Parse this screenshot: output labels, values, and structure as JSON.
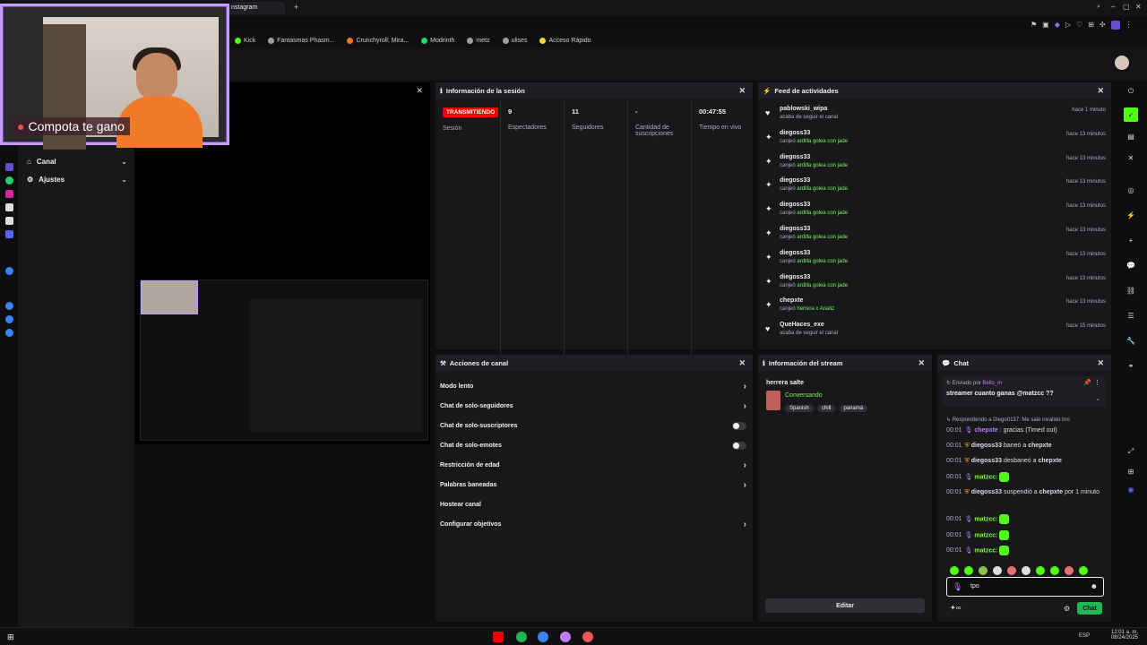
{
  "browser": {
    "tab_title": "nstagram",
    "new_tab_glyph": "+",
    "bookmarks": [
      {
        "label": "Kick",
        "color": "#53fc18"
      },
      {
        "label": "Fantasmas Phasm...",
        "color": "#9e9e9e"
      },
      {
        "label": "Crunchyroll: Mira...",
        "color": "#f47521"
      },
      {
        "label": "Modrinth",
        "color": "#1bd96a"
      },
      {
        "label": "metz",
        "color": "#9e9e9e"
      },
      {
        "label": "ulises",
        "color": "#9e9e9e"
      },
      {
        "label": "Acceso Rápido",
        "color": "#f5d442"
      }
    ]
  },
  "webcam": {
    "caption": "Compota te gano"
  },
  "sidenav": {
    "items": [
      {
        "label": "Canal",
        "chevron": "⌄"
      },
      {
        "label": "Ajustes",
        "chevron": "⌄"
      }
    ]
  },
  "session": {
    "title": "Información de la sesión",
    "live_badge": "TRANSMITIENDO",
    "session_label": "Sesión",
    "stats": [
      {
        "value": "9",
        "label": "Espectadores"
      },
      {
        "value": "11",
        "label": "Seguidores"
      },
      {
        "value": "-",
        "label": "Cantidad de suscripciones"
      },
      {
        "value": "00:47:55",
        "label": "Tiempo en vivo"
      }
    ]
  },
  "feed": {
    "title": "Feed de actividades",
    "items": [
      {
        "user": "pablowski_wipa",
        "desc": "acaba de seguir el canal",
        "highlight": "",
        "time": "hace 1 minuto",
        "icon": "heart"
      },
      {
        "user": "diegoss33",
        "desc": "canjeó",
        "highlight": "ardilla golea con jade",
        "time": "hace 13 minutos",
        "icon": "points"
      },
      {
        "user": "diegoss33",
        "desc": "canjeó",
        "highlight": "ardilla golea con jade",
        "time": "hace 13 minutos",
        "icon": "points"
      },
      {
        "user": "diegoss33",
        "desc": "canjeó",
        "highlight": "ardilla golea con jade",
        "time": "hace 13 minutos",
        "icon": "points"
      },
      {
        "user": "diegoss33",
        "desc": "canjeó",
        "highlight": "ardilla golea con jade",
        "time": "hace 13 minutos",
        "icon": "points"
      },
      {
        "user": "diegoss33",
        "desc": "canjeó",
        "highlight": "ardilla golea con jade",
        "time": "hace 13 minutos",
        "icon": "points"
      },
      {
        "user": "diegoss33",
        "desc": "canjeó",
        "highlight": "ardilla golea con jade",
        "time": "hace 13 minutos",
        "icon": "points"
      },
      {
        "user": "diegoss33",
        "desc": "canjeó",
        "highlight": "ardilla golea con jade",
        "time": "hace 13 minutos",
        "icon": "points"
      },
      {
        "user": "chepxte",
        "desc": "canjeó",
        "highlight": "herrera x Analiz",
        "time": "hace 13 minutos",
        "icon": "points"
      },
      {
        "user": "QueHaces_exe",
        "desc": "acaba de seguir el canal",
        "highlight": "",
        "time": "hace 15 minutos",
        "icon": "heart"
      }
    ]
  },
  "actions": {
    "title": "Acciones de canal",
    "rows": [
      {
        "label": "Modo lento",
        "control": "chevron"
      },
      {
        "label": "Chat de solo-seguidores",
        "control": "chevron"
      },
      {
        "label": "Chat de solo-suscriptores",
        "control": "toggle"
      },
      {
        "label": "Chat de solo-emotes",
        "control": "toggle"
      },
      {
        "label": "Restricción de edad",
        "control": "chevron"
      },
      {
        "label": "Palabras baneadas",
        "control": "chevron"
      },
      {
        "label": "Hostear canal",
        "control": "none"
      },
      {
        "label": "Configurar objetivos",
        "control": "chevron"
      }
    ]
  },
  "stream_info": {
    "title": "Información del stream",
    "stream_title": "herrera salte",
    "category": "Conversando",
    "tags": [
      "Spanish",
      "chill",
      "panamá"
    ],
    "edit_label": "Editar"
  },
  "chat": {
    "title": "Chat",
    "pinned_from_prefix": "Enviado por",
    "pinned_from_user": "Bello_m",
    "pinned_text": "streamer cuanto ganas @matzcc ??",
    "reply_hint": "Respondiendo a Diego0137: Me sale invalido bro",
    "messages": [
      {
        "time": "00:01",
        "user": "chepxte",
        "text": ": gracias (Timed out)",
        "color": "#c27bff",
        "emote": false
      },
      {
        "time": "00:01",
        "user": "diegoss33",
        "text": "baneó a",
        "target": "chepxte",
        "color": "#dedee3",
        "emote": false
      },
      {
        "time": "00:01",
        "user": "diegoss33",
        "text": "desbaneó a",
        "target": "chepxte",
        "color": "#dedee3",
        "emote": false
      },
      {
        "time": "00:01",
        "user": "matzcc:",
        "text": "",
        "color": "#7bf55a",
        "emote": true
      },
      {
        "time": "00:01",
        "user": "diegoss33",
        "text": "suspendió a",
        "target": "chepxte",
        "extra": "por 1 minuto",
        "color": "#dedee3",
        "emote": false
      },
      {
        "time": "00:01",
        "user": "matzcc:",
        "text": "",
        "color": "#7bf55a",
        "emote": true
      },
      {
        "time": "00:01",
        "user": "matzcc:",
        "text": "",
        "color": "#7bf55a",
        "emote": true
      },
      {
        "time": "00:01",
        "user": "matzcc:",
        "text": "",
        "color": "#7bf55a",
        "emote": true
      }
    ],
    "input_value": "tpo",
    "send_label": "Chat"
  },
  "taskbar": {
    "language": "ESP",
    "time": "12:01 a. m.",
    "date": "08/24/2025"
  },
  "colors": {
    "accent": "#53fc18",
    "live": "#eb0400",
    "webcam_border": "#c79bff"
  }
}
